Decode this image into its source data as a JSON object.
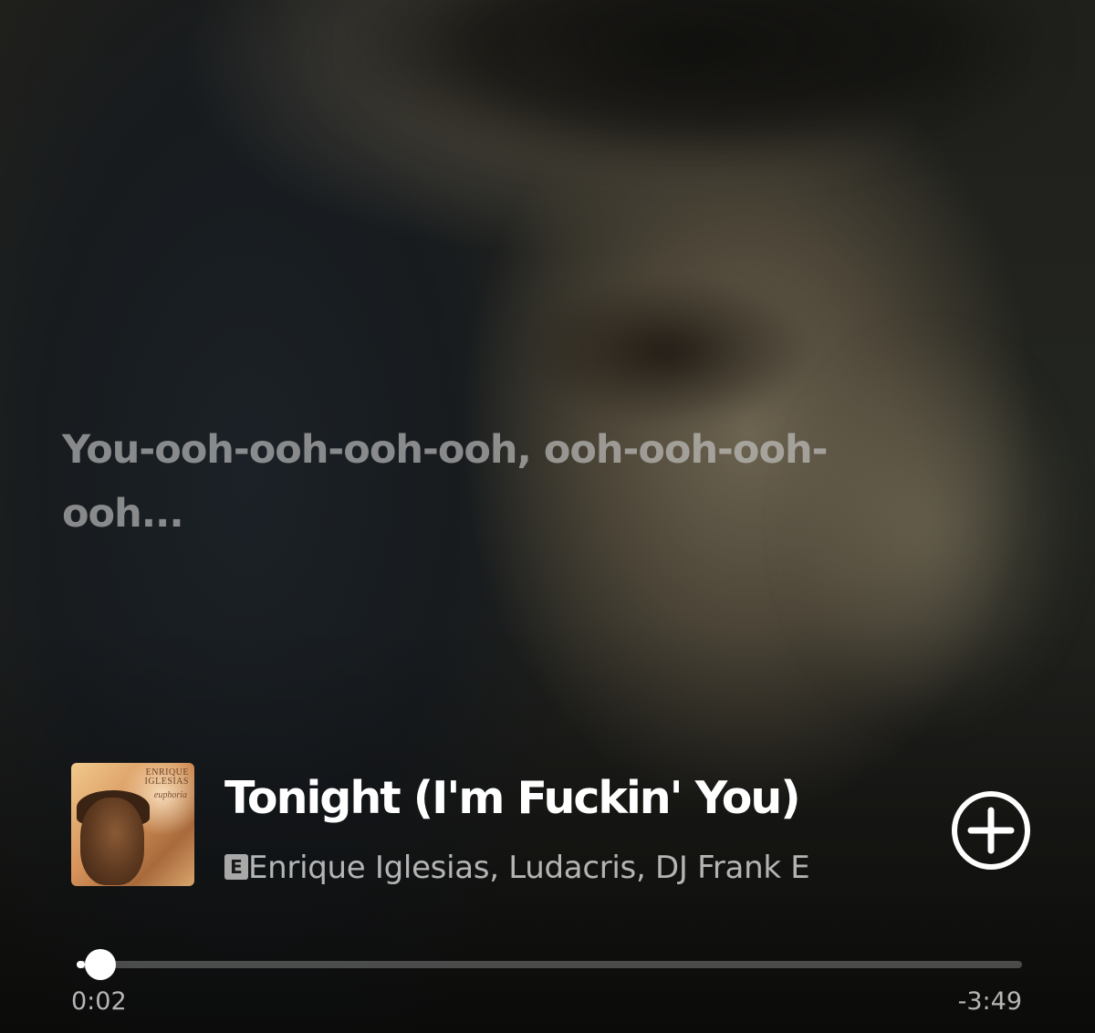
{
  "lyrics": {
    "current_line": "You-ooh-ooh-ooh-ooh, ooh-ooh-ooh-ooh..."
  },
  "track": {
    "title": "Tonight (I'm Fuckin' You)",
    "explicit_badge": "E",
    "artists": "Enrique Iglesias, Ludacris, DJ Frank E",
    "album_art": {
      "artist_text": "ENRIQUE\nIGLESIAS",
      "album_text": "euphoria"
    },
    "add_icon": "plus-circle-icon"
  },
  "playback": {
    "elapsed": "0:02",
    "remaining": "-3:49",
    "progress_fraction": 0.009
  },
  "colors": {
    "text_primary": "#ffffff",
    "lyric_dimmed": "#cdcdcd",
    "progress_track": "#969696",
    "progress_fill": "#ffffff"
  }
}
